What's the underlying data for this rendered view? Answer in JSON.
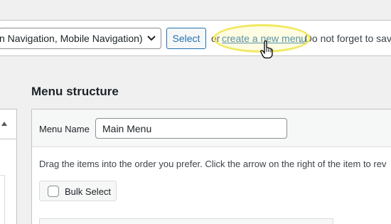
{
  "menu_select": {
    "value": "n Navigation, Mobile Navigation)"
  },
  "select_button": {
    "label": "Select"
  },
  "create_line": {
    "prefix": "or",
    "link": "create a new menu",
    "suffix": ". Do not forget to save"
  },
  "menu_structure": {
    "title": "Menu structure",
    "name_label": "Menu Name",
    "name_value": "Main Menu",
    "instructions": "Drag the items into the order you prefer. Click the arrow on the right of the item to rev",
    "bulk_select_label": "Bulk Select"
  },
  "icons": {
    "dropdown": "chevron-down-icon",
    "collapse": "arrow-up-icon",
    "cursor": "hand-pointer-icon"
  },
  "colors": {
    "link": "#2271b1",
    "highlight": "#f0e960",
    "background": "#f0f0f1"
  }
}
